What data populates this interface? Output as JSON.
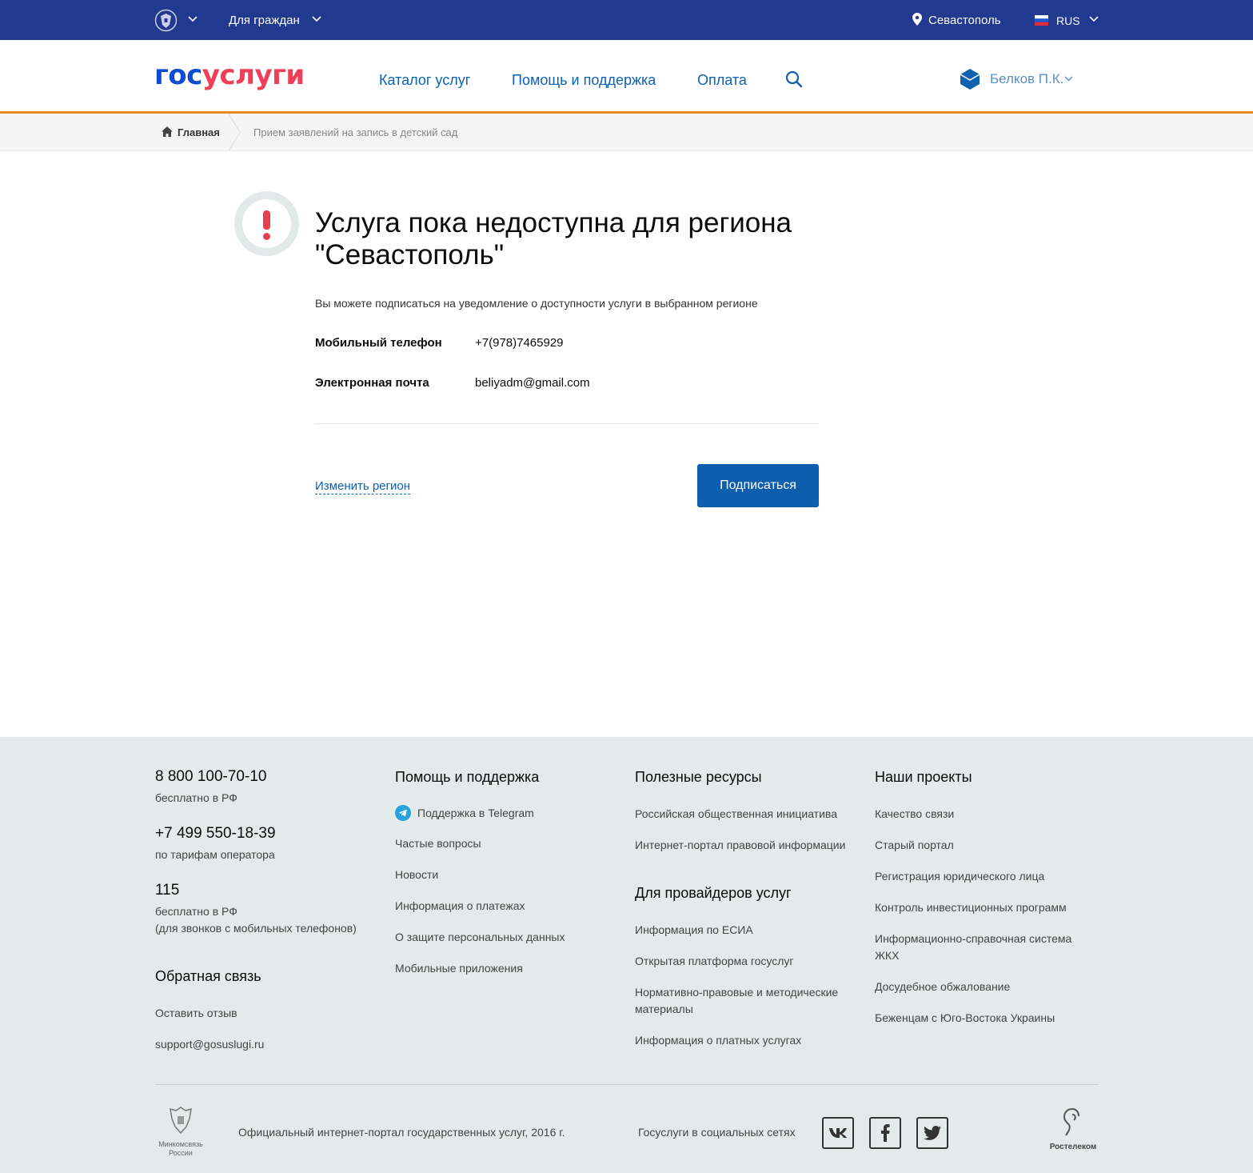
{
  "topbar": {
    "audience": "Для граждан",
    "city": "Севастополь",
    "language": "RUS"
  },
  "header": {
    "logo_part1": "гос",
    "logo_part2": "услуги",
    "nav": [
      "Каталог услуг",
      "Помощь и поддержка",
      "Оплата"
    ],
    "user": "Белков П.К."
  },
  "breadcrumb": {
    "home": "Главная",
    "current": "Прием заявлений на запись в детский сад"
  },
  "main": {
    "title_line1": "Услуга пока недоступна для региона",
    "title_line2": "\"Севастополь\"",
    "subtitle": "Вы можете подписаться на уведомление о доступности услуги в выбранном регионе",
    "phone_label": "Мобильный телефон",
    "phone_value": "+7(978)7465929",
    "email_label": "Электронная почта",
    "email_value": "beliyadm@gmail.com",
    "change_region": "Изменить регион",
    "subscribe": "Подписаться"
  },
  "footer": {
    "phones": [
      {
        "number": "8 800 100-70-10",
        "note": "бесплатно в РФ"
      },
      {
        "number": "+7 499 550-18-39",
        "note": "по тарифам оператора"
      },
      {
        "number": "115",
        "note": "бесплатно в РФ",
        "note2": "(для звонков с мобильных телефонов)"
      }
    ],
    "feedback": {
      "title": "Обратная связь",
      "links": [
        "Оставить отзыв",
        "support@gosuslugi.ru"
      ]
    },
    "help": {
      "title": "Помощь и поддержка",
      "links": [
        "Поддержка в Telegram",
        "Частые вопросы",
        "Новости",
        "Информация о платежах",
        "О защите персональных данных",
        "Мобильные приложения"
      ]
    },
    "resources": {
      "title": "Полезные ресурсы",
      "links": [
        "Российская общественная инициатива",
        "Интернет-портал правовой информации"
      ]
    },
    "providers": {
      "title": "Для провайдеров услуг",
      "links": [
        "Информация по ЕСИА",
        "Открытая платформа госуслуг",
        "Нормативно-правовые и методические",
        "материалы",
        "Информация о платных услугах"
      ]
    },
    "projects": {
      "title": "Наши проекты",
      "links": [
        "Качество связи",
        "Старый портал",
        "Регистрация юридического лица",
        "Контроль инвестиционных программ",
        "Информационно-справочная система",
        "ЖКХ",
        "Досудебное обжалование",
        "Беженцам с Юго-Востока Украины"
      ]
    },
    "ministry_line1": "Минкомсвязь",
    "ministry_line2": "России",
    "copyright": "Официальный интернет-портал государственных услуг, 2016 г.",
    "social_label": "Госуслуги в социальных сетях",
    "rostelecom": "Ростелеком",
    "social": [
      "vk-icon",
      "facebook-icon",
      "twitter-icon"
    ]
  },
  "colors": {
    "topbar": "#213a8f",
    "accent_orange": "#ee8a1f",
    "button": "#0d5fad",
    "alert": "#e8404b"
  }
}
